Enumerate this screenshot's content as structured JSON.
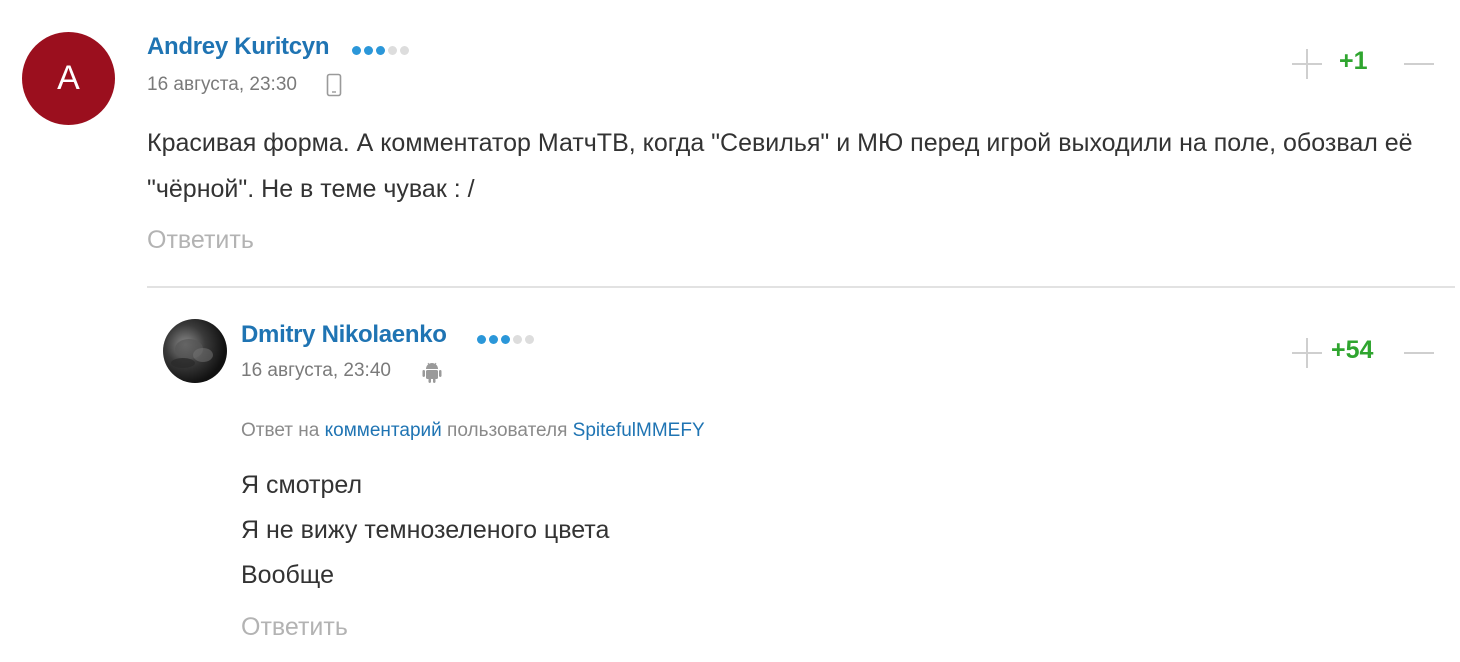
{
  "comments": [
    {
      "avatar_letter": "A",
      "author": "Andrey Kuritcyn",
      "rating_dots_on": 3,
      "rating_dots_total": 5,
      "date": "16 августа, 23:30",
      "device_icon": "mobile-phone-icon",
      "text": "Красивая форма. А комментатор МатчТВ, когда \"Севилья\" и МЮ перед игрой выходили на поле, обозвал её \"чёрной\". Не в теме чувак : /",
      "reply_label": "Ответить",
      "score": "+1"
    },
    {
      "author": "Dmitry Nikolaenko",
      "rating_dots_on": 3,
      "rating_dots_total": 5,
      "date": "16 августа, 23:40",
      "device_icon": "android-icon",
      "reply_prefix": "Ответ на",
      "reply_link": "комментарий",
      "reply_middle": "пользователя",
      "reply_user": "SpitefulMMEFY",
      "lines": [
        "Я смотрел",
        "Я не вижу темнозеленого цвета",
        "Вообще"
      ],
      "reply_label": "Ответить",
      "score": "+54"
    }
  ],
  "colors": {
    "author": "#1f74b3",
    "score": "#2fa52f",
    "avatar_bg": "#9b0f1e",
    "dot_on": "#2b97d9",
    "dot_off": "#dddddd"
  }
}
